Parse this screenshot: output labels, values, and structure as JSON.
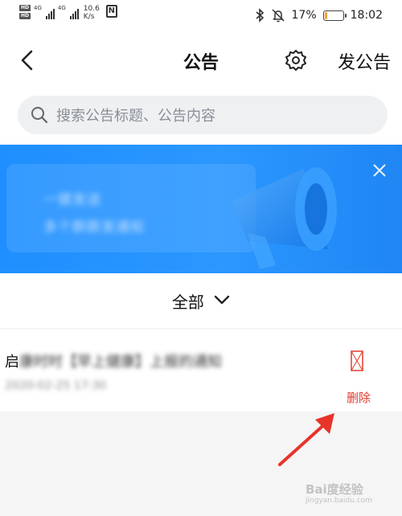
{
  "status_bar": {
    "hd1": "HD",
    "hd2": "HD",
    "net1": "4G",
    "net2": "4G",
    "speed_value": "10.6",
    "speed_unit": "K/s",
    "nfc": "N",
    "battery": "17%",
    "battery_level": 0.17,
    "battery_color": "#f2a23a",
    "time": "18:02"
  },
  "header": {
    "title": "公告",
    "post_label": "发公告"
  },
  "search": {
    "placeholder": "搜索公告标题、公告内容"
  },
  "banner": {
    "line1": "一键发送",
    "line2": "多个群群发通知"
  },
  "filter": {
    "label": "全部"
  },
  "list": {
    "items": [
      {
        "title_prefix": "启",
        "title_rest": "康时时【早上健康】上报的通知",
        "meta": "2020-02-25 17:30"
      }
    ]
  },
  "actions": {
    "delete_label": "删除",
    "delete_color": "#e23b2e"
  },
  "watermark": {
    "text": "Bai度经验",
    "sub": "jingyan.baidu.com"
  }
}
